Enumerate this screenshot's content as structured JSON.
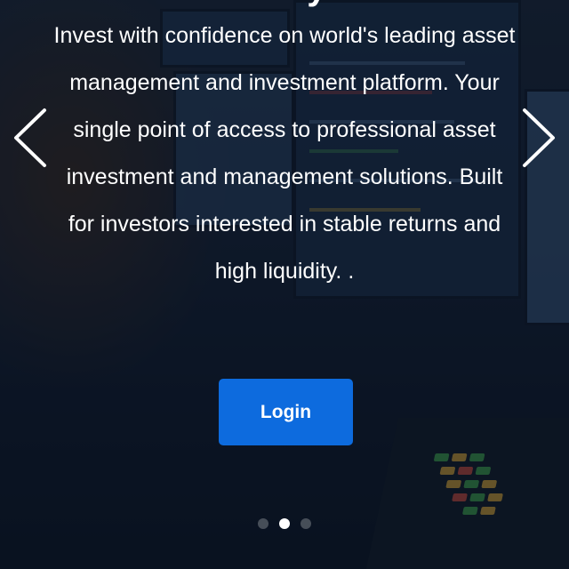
{
  "hero": {
    "title": "Our Vision to your future",
    "description": "Invest with confidence on world's leading asset management and investment platform. Your single point of access to professional asset investment and management solutions. Built for investors interested in stable returns and high liquidity. .",
    "login_label": "Login"
  },
  "carousel": {
    "prev_icon": "chevron-left-icon",
    "next_icon": "chevron-right-icon",
    "slide_count": 3,
    "active_slide": 2
  },
  "colors": {
    "button": "#0d6bde",
    "overlay": "#0a1220",
    "text": "#ffffff"
  }
}
